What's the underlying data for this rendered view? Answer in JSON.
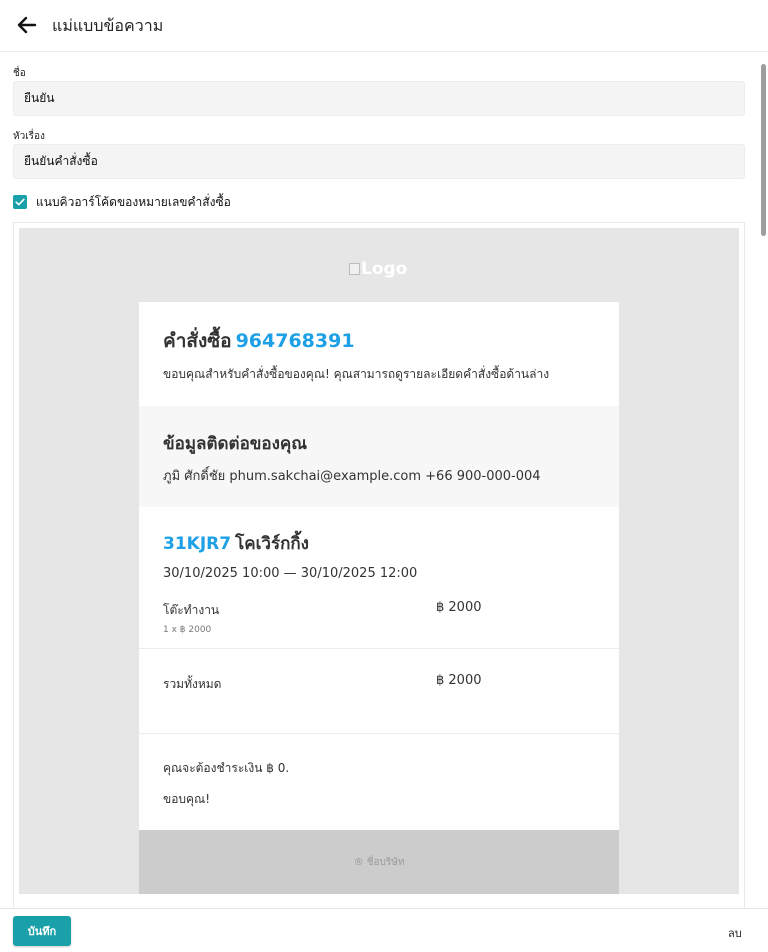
{
  "header": {
    "title": "แม่แบบข้อความ",
    "back_icon": "arrow-left-icon"
  },
  "form": {
    "name_label": "ชื่อ",
    "name_value": "ยืนยัน",
    "subject_label": "หัวเรื่อง",
    "subject_value": "ยืนยันคำสั่งซื้อ",
    "qr_checkbox_label": "แนบคิวอาร์โค้ดของหมายเลขคำสั่งซื้อ",
    "qr_checkbox_checked": true
  },
  "preview": {
    "logo_alt": "Logo",
    "order_heading": "คำสั่งซื้อ",
    "order_number": "964768391",
    "order_message": "ขอบคุณสำหรับคำสั่งซื้อของคุณ! คุณสามารถดูรายละเอียดคำสั่งซื้อด้านล่าง",
    "contact_heading": "ข้อมูลติดต่อของคุณ",
    "contact_line": "ภูมิ ศักดิ์ชัย phum.sakchai@example.com +66 900-000-004",
    "booking_code": "31KJR7",
    "booking_name": "โคเวิร์กกิ้ง",
    "booking_period": "30/10/2025 10:00 — 30/10/2025 12:00",
    "item_name": "โต๊ะทำงาน",
    "item_price": "฿ 2000",
    "item_qty": "1 x ฿ 2000",
    "total_label": "รวมทั้งหมด",
    "total_price": "฿ 2000",
    "payment_note": "คุณจะต้องชำระเงิน ฿ 0.",
    "thanks": "ขอบคุณ!",
    "footer": "® ชื่อบริษัท"
  },
  "actions": {
    "save_label": "บันทึก",
    "delete_label": "ลบ"
  },
  "colors": {
    "accent": "#1aa0a8",
    "link_blue": "#1ea0e6"
  }
}
